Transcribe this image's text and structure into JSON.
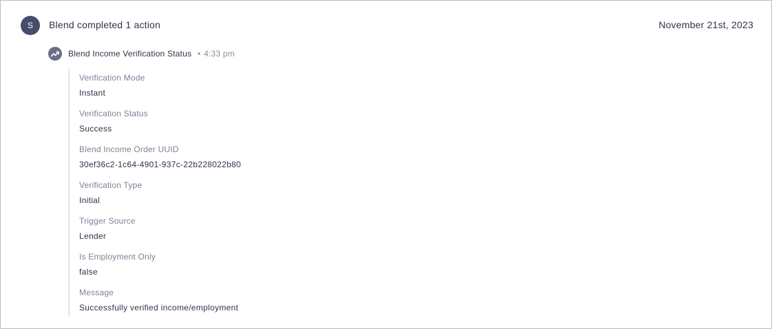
{
  "header": {
    "avatar_initial": "S",
    "title": "Blend completed 1 action",
    "date": "November 21st, 2023"
  },
  "event": {
    "icon": "trending-up-icon",
    "title": "Blend Income Verification Status",
    "separator": "•",
    "time": "4:33 pm"
  },
  "fields": [
    {
      "label": "Verification Mode",
      "value": "Instant"
    },
    {
      "label": "Verification Status",
      "value": "Success"
    },
    {
      "label": "Blend Income Order UUID",
      "value": "30ef36c2-1c64-4901-937c-22b228022b80"
    },
    {
      "label": "Verification Type",
      "value": "Initial"
    },
    {
      "label": "Trigger Source",
      "value": "Lender"
    },
    {
      "label": "Is Employment Only",
      "value": "false"
    },
    {
      "label": "Message",
      "value": "Successfully verified income/employment"
    }
  ],
  "colors": {
    "avatar_bg": "#464c6b",
    "event_icon_bg": "#6a6f83",
    "text_primary": "#2f3447",
    "text_muted": "#7d8194",
    "divider": "#e4e5ea",
    "border": "#b9bcc4"
  }
}
